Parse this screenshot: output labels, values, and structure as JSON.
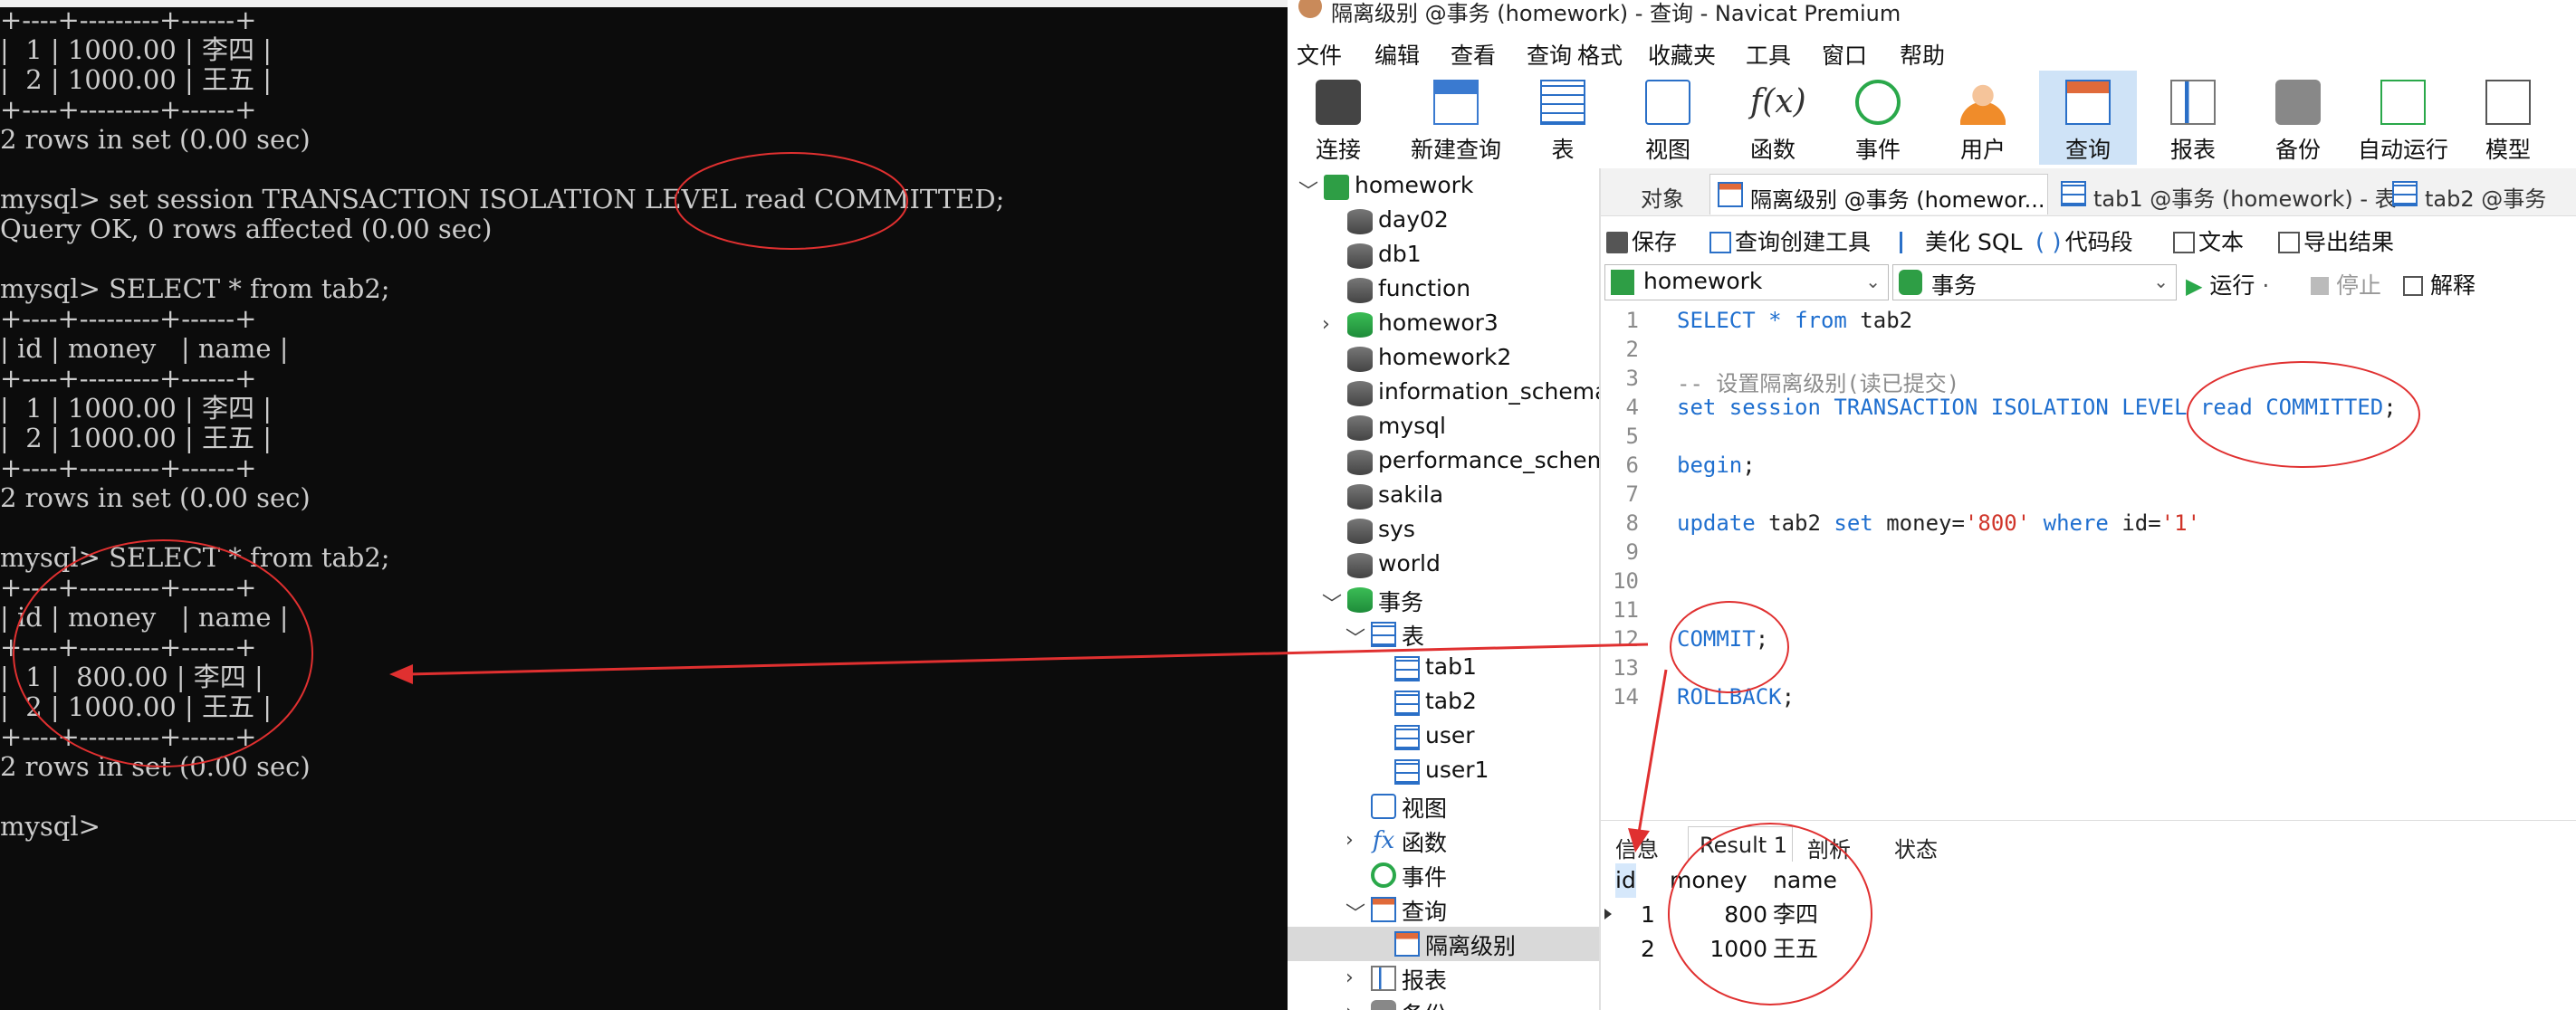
{
  "terminal": {
    "lines": [
      "+----+---------+------+",
      "|  1 | 1000.00 | 李四 |",
      "|  2 | 1000.00 | 王五 |",
      "+----+---------+------+",
      "2 rows in set (0.00 sec)",
      "",
      "mysql> set session TRANSACTION ISOLATION LEVEL read COMMITTED;",
      "Query OK, 0 rows affected (0.00 sec)",
      "",
      "mysql> SELECT * from tab2;",
      "+----+---------+------+",
      "| id | money   | name |",
      "+----+---------+------+",
      "|  1 | 1000.00 | 李四 |",
      "|  2 | 1000.00 | 王五 |",
      "+----+---------+------+",
      "2 rows in set (0.00 sec)",
      "",
      "mysql> SELECT * from tab2;",
      "+----+---------+------+",
      "| id | money   | name |",
      "+----+---------+------+",
      "|  1 |  800.00 | 李四 |",
      "|  2 | 1000.00 | 王五 |",
      "+----+---------+------+",
      "2 rows in set (0.00 sec)",
      "",
      "mysql>"
    ]
  },
  "window": {
    "title": "隔离级别 @事务 (homework) - 查询 - Navicat Premium"
  },
  "menu": [
    "文件",
    "编辑",
    "查看",
    "查询",
    "格式",
    "收藏夹",
    "工具",
    "窗口",
    "帮助"
  ],
  "toolbar": [
    {
      "label": "连接",
      "icon": "plug-icon"
    },
    {
      "label": "新建查询",
      "icon": "new-query-icon"
    },
    {
      "label": "表",
      "icon": "table-icon"
    },
    {
      "label": "视图",
      "icon": "view-icon"
    },
    {
      "label": "函数",
      "icon": "function-icon",
      "glyph": "f(x)"
    },
    {
      "label": "事件",
      "icon": "clock-icon"
    },
    {
      "label": "用户",
      "icon": "user-icon"
    },
    {
      "label": "查询",
      "icon": "query-icon",
      "active": true
    },
    {
      "label": "报表",
      "icon": "report-icon"
    },
    {
      "label": "备份",
      "icon": "backup-icon"
    },
    {
      "label": "自动运行",
      "icon": "autorun-icon"
    },
    {
      "label": "模型",
      "icon": "model-icon"
    }
  ],
  "sidebar": {
    "items": [
      {
        "label": "homework",
        "level": 0,
        "arrow": "﹀",
        "icon": "connection-icon"
      },
      {
        "label": "day02",
        "level": 1,
        "icon": "database-icon"
      },
      {
        "label": "db1",
        "level": 1,
        "icon": "database-icon"
      },
      {
        "label": "function",
        "level": 1,
        "icon": "database-icon"
      },
      {
        "label": "homewor3",
        "level": 1,
        "arrow": "›",
        "icon": "database-open-icon"
      },
      {
        "label": "homework2",
        "level": 1,
        "icon": "database-icon"
      },
      {
        "label": "information_schema",
        "level": 1,
        "icon": "database-icon"
      },
      {
        "label": "mysql",
        "level": 1,
        "icon": "database-icon"
      },
      {
        "label": "performance_schema",
        "level": 1,
        "icon": "database-icon"
      },
      {
        "label": "sakila",
        "level": 1,
        "icon": "database-icon"
      },
      {
        "label": "sys",
        "level": 1,
        "icon": "database-icon"
      },
      {
        "label": "world",
        "level": 1,
        "icon": "database-icon"
      },
      {
        "label": "事务",
        "level": 1,
        "arrow": "﹀",
        "icon": "database-open-icon"
      },
      {
        "label": "表",
        "level": 2,
        "arrow": "﹀",
        "icon": "table-icon"
      },
      {
        "label": "tab1",
        "level": 3,
        "icon": "table-icon"
      },
      {
        "label": "tab2",
        "level": 3,
        "icon": "table-icon"
      },
      {
        "label": "user",
        "level": 3,
        "icon": "table-icon"
      },
      {
        "label": "user1",
        "level": 3,
        "icon": "table-icon"
      },
      {
        "label": "视图",
        "level": 2,
        "icon": "view-icon"
      },
      {
        "label": "函数",
        "level": 2,
        "arrow": "›",
        "icon": "function-icon"
      },
      {
        "label": "事件",
        "level": 2,
        "icon": "clock-icon"
      },
      {
        "label": "查询",
        "level": 2,
        "arrow": "﹀",
        "icon": "query-icon"
      },
      {
        "label": "隔离级别",
        "level": 3,
        "icon": "query-icon",
        "selected": true
      },
      {
        "label": "报表",
        "level": 2,
        "arrow": "›",
        "icon": "report-icon"
      },
      {
        "label": "备份",
        "level": 2,
        "arrow": "›",
        "icon": "backup-icon"
      }
    ]
  },
  "tabs": [
    {
      "label": "对象"
    },
    {
      "label": "隔离级别 @事务 (homewor...",
      "active": true,
      "icon": "query-icon"
    },
    {
      "label": "tab1 @事务 (homework) - 表",
      "icon": "table-icon"
    },
    {
      "label": "tab2 @事务",
      "icon": "table-icon"
    }
  ],
  "query_toolbar": {
    "save": "保存",
    "builder": "查询创建工具",
    "beautify": "美化 SQL",
    "snippet": "代码段",
    "text": "文本",
    "export": "导出结果"
  },
  "selectors": {
    "connection": "homework",
    "database": "事务",
    "run": "运行",
    "stop": "停止",
    "explain": "解释"
  },
  "code": [
    {
      "n": "1",
      "parts": [
        [
          "kw",
          "SELECT"
        ],
        [
          "plain",
          " "
        ],
        [
          "kw",
          "*"
        ],
        [
          "plain",
          " "
        ],
        [
          "kw",
          "from"
        ],
        [
          "plain",
          " tab2"
        ]
      ]
    },
    {
      "n": "2",
      "parts": []
    },
    {
      "n": "3",
      "parts": [
        [
          "cmt",
          "-- 设置隔离级别(读已提交)"
        ]
      ]
    },
    {
      "n": "4",
      "parts": [
        [
          "kw",
          "set session TRANSACTION ISOLATION LEVEL read COMMITTED"
        ],
        [
          "plain",
          ";"
        ]
      ]
    },
    {
      "n": "5",
      "parts": []
    },
    {
      "n": "6",
      "parts": [
        [
          "kw",
          "begin"
        ],
        [
          "plain",
          ";"
        ]
      ]
    },
    {
      "n": "7",
      "parts": []
    },
    {
      "n": "8",
      "parts": [
        [
          "kw",
          "update"
        ],
        [
          "plain",
          " tab2 "
        ],
        [
          "kw",
          "set"
        ],
        [
          "plain",
          " money="
        ],
        [
          "str",
          "'800'"
        ],
        [
          "plain",
          " "
        ],
        [
          "kw",
          "where"
        ],
        [
          "plain",
          " id="
        ],
        [
          "str",
          "'1'"
        ]
      ]
    },
    {
      "n": "9",
      "parts": []
    },
    {
      "n": "10",
      "parts": []
    },
    {
      "n": "11",
      "parts": []
    },
    {
      "n": "12",
      "parts": [
        [
          "kw",
          "COMMIT"
        ],
        [
          "plain",
          ";"
        ]
      ]
    },
    {
      "n": "13",
      "parts": []
    },
    {
      "n": "14",
      "parts": [
        [
          "kw",
          "ROLLBACK"
        ],
        [
          "plain",
          ";"
        ]
      ]
    }
  ],
  "result_tabs": [
    {
      "label": "信息"
    },
    {
      "label": "Result 1",
      "active": true
    },
    {
      "label": "剖析"
    },
    {
      "label": "状态"
    }
  ],
  "result": {
    "headers": [
      "id",
      "money",
      "name"
    ],
    "rows": [
      [
        "1",
        "800",
        "李四"
      ],
      [
        "2",
        "1000",
        "王五"
      ]
    ]
  },
  "colors": {
    "accent": "#1f6fcf",
    "annotation": "#e03030",
    "terminal_bg": "#0c0c0c",
    "terminal_fg": "#cccccc"
  }
}
